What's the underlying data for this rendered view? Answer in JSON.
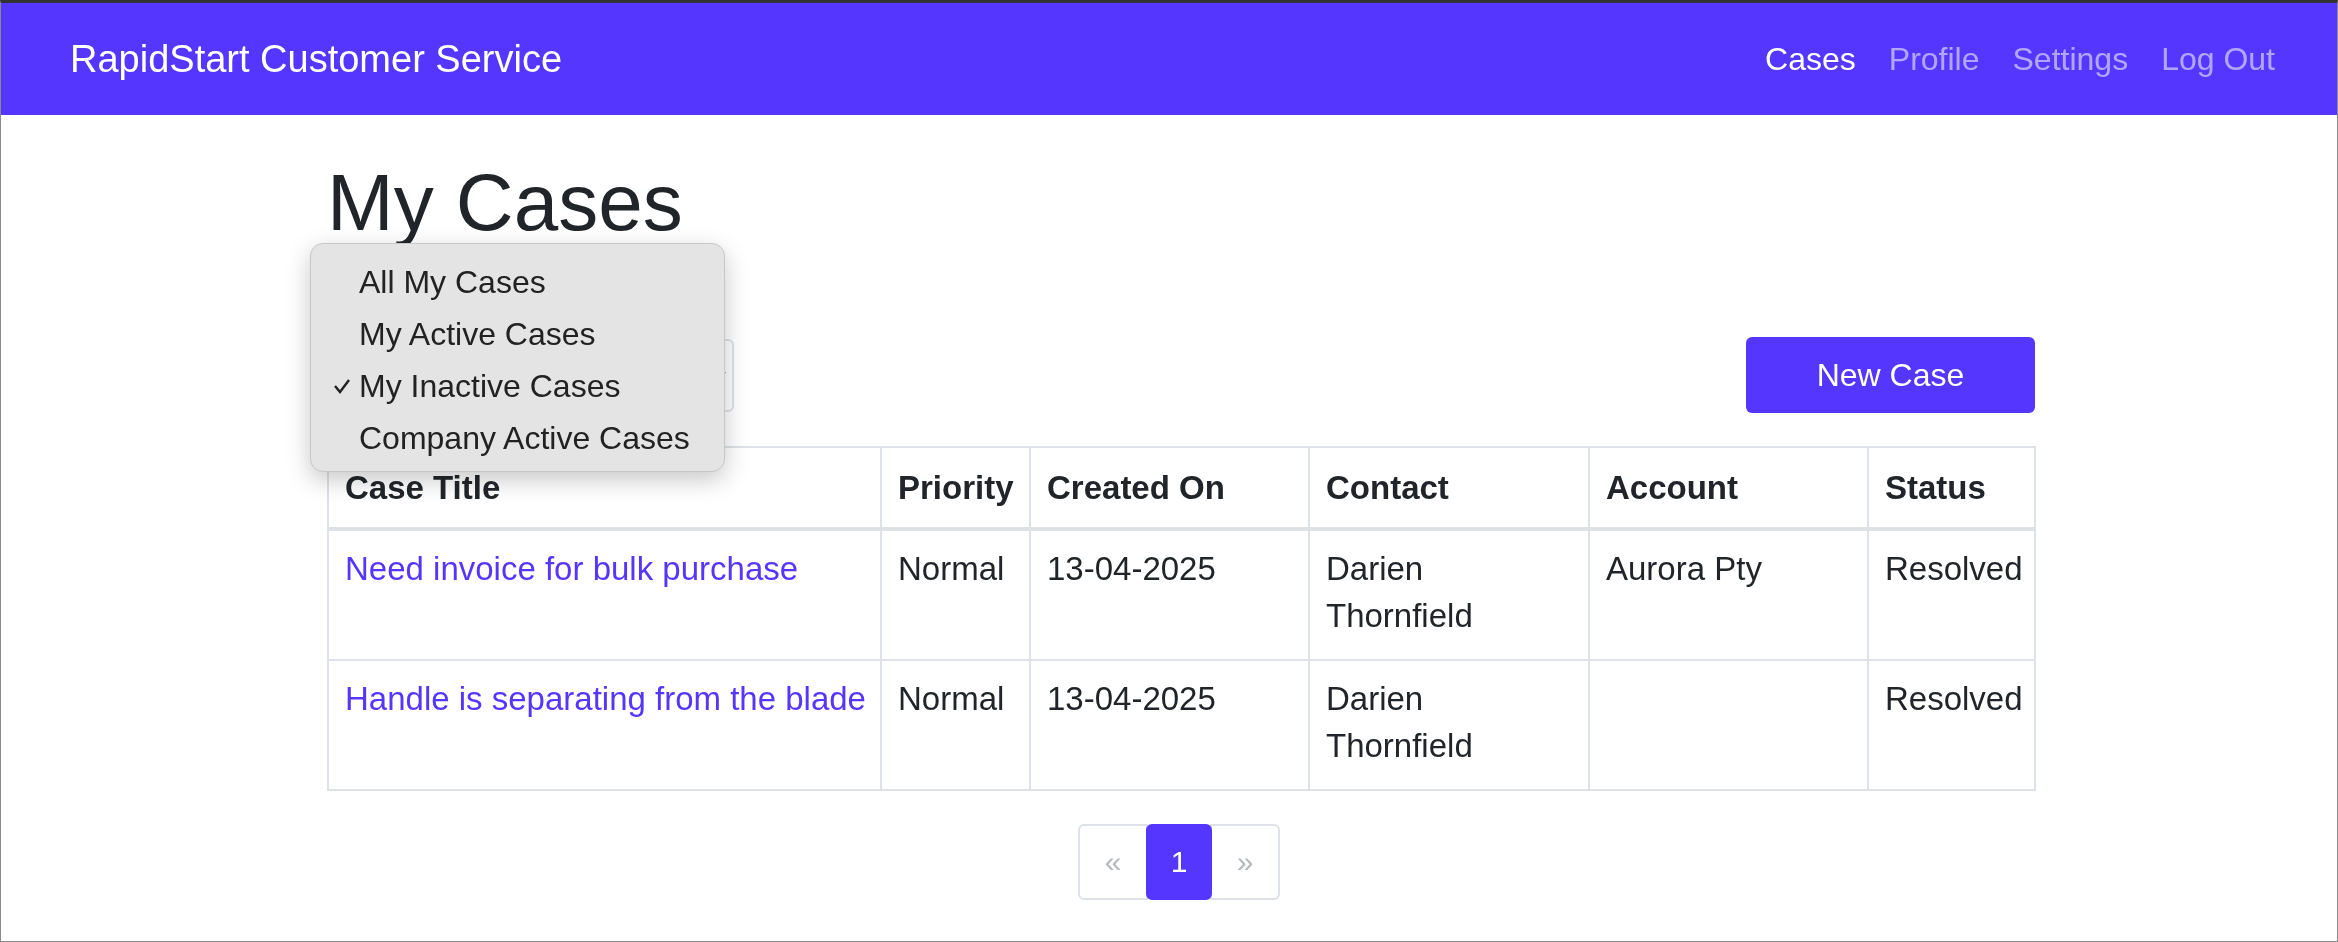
{
  "navbar": {
    "brand": "RapidStart Customer Service",
    "links": [
      {
        "label": "Cases",
        "selected": true
      },
      {
        "label": "Profile",
        "selected": false
      },
      {
        "label": "Settings",
        "selected": false
      },
      {
        "label": "Log Out",
        "selected": false
      }
    ]
  },
  "heading": "My Cases",
  "view_menu": {
    "options": [
      {
        "label": "All My Cases",
        "selected": false
      },
      {
        "label": "My Active Cases",
        "selected": false
      },
      {
        "label": "My Inactive Cases",
        "selected": true
      },
      {
        "label": "Company Active Cases",
        "selected": false
      }
    ]
  },
  "new_case_button": "New Case",
  "table": {
    "columns": [
      "Case Title",
      "Priority",
      "Created On",
      "Contact",
      "Account",
      "Status"
    ],
    "rows": [
      {
        "title": "Need invoice for bulk purchase",
        "priority": "Normal",
        "created_on": "13-04-2025",
        "contact": "Darien Thornfield",
        "account": "Aurora Pty",
        "status": "Resolved"
      },
      {
        "title": "Handle is separating from the blade",
        "priority": "Normal",
        "created_on": "13-04-2025",
        "contact": "Darien Thornfield",
        "account": "",
        "status": "Resolved"
      }
    ]
  },
  "pagination": [
    {
      "label": "«",
      "kind": "prev",
      "disabled": true,
      "selected": false
    },
    {
      "label": "1",
      "kind": "page",
      "disabled": false,
      "selected": true
    },
    {
      "label": "»",
      "kind": "next",
      "disabled": true,
      "selected": false
    }
  ]
}
